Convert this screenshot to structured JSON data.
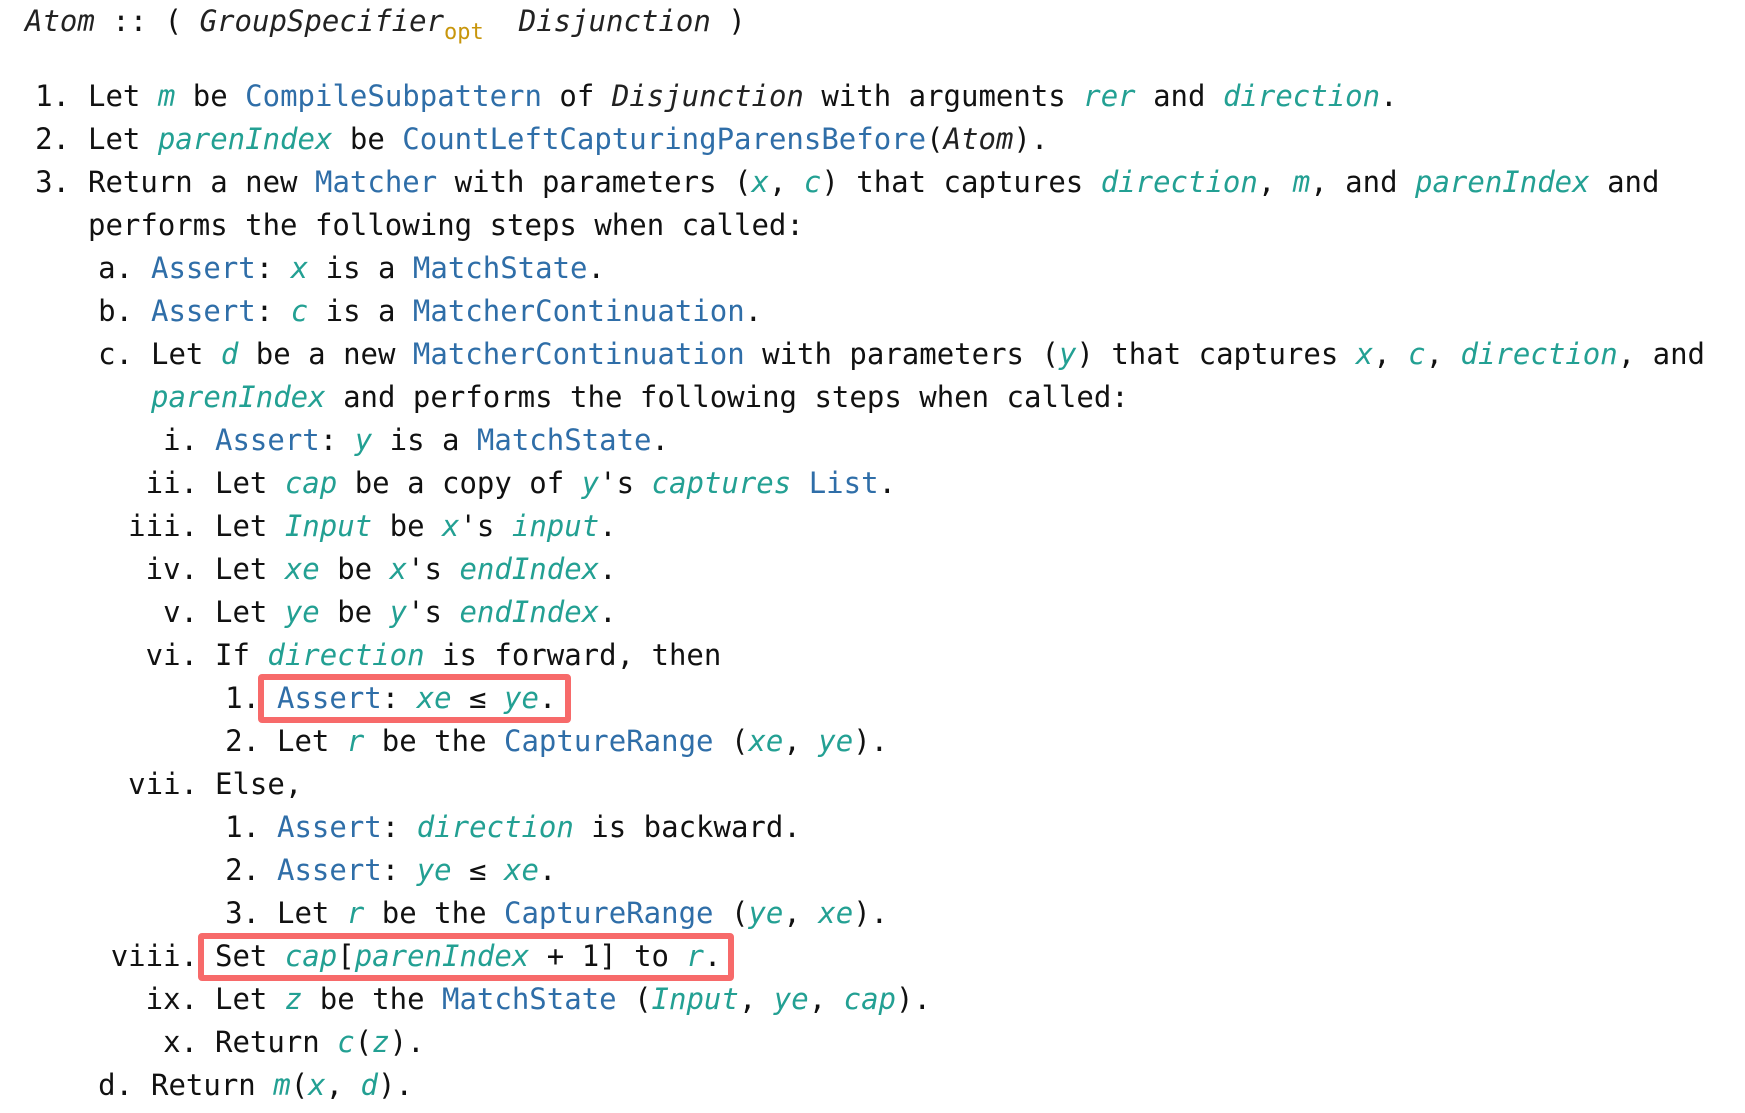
{
  "accent_colors": {
    "link": "#2f6ea8",
    "variable": "#23a093",
    "subscript": "#c8960c",
    "highlight_box": "#f76a6a"
  },
  "heading": [
    [
      "n",
      "Atom"
    ],
    [
      "t",
      " :: ( "
    ],
    [
      "n",
      "GroupSpecifier"
    ],
    [
      "sub",
      "opt"
    ],
    [
      "t",
      "  "
    ],
    [
      "n",
      "Disjunction"
    ],
    [
      "t",
      " )"
    ]
  ],
  "lines": [
    {
      "marker": "1.",
      "segments": [
        [
          "t",
          "Let "
        ],
        [
          "v",
          "m"
        ],
        [
          "t",
          " be "
        ],
        [
          "a",
          "CompileSubpattern"
        ],
        [
          "t",
          " of "
        ],
        [
          "n",
          "Disjunction"
        ],
        [
          "t",
          " with arguments "
        ],
        [
          "v",
          "rer"
        ],
        [
          "t",
          " and "
        ],
        [
          "v",
          "direction"
        ],
        [
          "t",
          "."
        ]
      ]
    },
    {
      "marker": "2.",
      "segments": [
        [
          "t",
          "Let "
        ],
        [
          "v",
          "parenIndex"
        ],
        [
          "t",
          " be "
        ],
        [
          "a",
          "CountLeftCapturingParensBefore"
        ],
        [
          "t",
          "("
        ],
        [
          "n",
          "Atom"
        ],
        [
          "t",
          ")."
        ]
      ]
    },
    {
      "marker": "3.",
      "segments": [
        [
          "t",
          "Return a new "
        ],
        [
          "a",
          "Matcher"
        ],
        [
          "t",
          " with parameters ("
        ],
        [
          "v",
          "x"
        ],
        [
          "t",
          ", "
        ],
        [
          "v",
          "c"
        ],
        [
          "t",
          ") that captures "
        ],
        [
          "v",
          "direction"
        ],
        [
          "t",
          ", "
        ],
        [
          "v",
          "m"
        ],
        [
          "t",
          ", and "
        ],
        [
          "v",
          "parenIndex"
        ],
        [
          "t",
          " and"
        ]
      ]
    },
    {
      "marker": "",
      "segments": [
        [
          "t",
          "performs the following steps when called:"
        ]
      ]
    },
    {
      "marker": "a.",
      "segments": [
        [
          "a",
          "Assert"
        ],
        [
          "t",
          ": "
        ],
        [
          "v",
          "x"
        ],
        [
          "t",
          " is a "
        ],
        [
          "a",
          "MatchState"
        ],
        [
          "t",
          "."
        ]
      ]
    },
    {
      "marker": "b.",
      "segments": [
        [
          "a",
          "Assert"
        ],
        [
          "t",
          ": "
        ],
        [
          "v",
          "c"
        ],
        [
          "t",
          " is a "
        ],
        [
          "a",
          "MatcherContinuation"
        ],
        [
          "t",
          "."
        ]
      ]
    },
    {
      "marker": "c.",
      "segments": [
        [
          "t",
          "Let "
        ],
        [
          "v",
          "d"
        ],
        [
          "t",
          " be a new "
        ],
        [
          "a",
          "MatcherContinuation"
        ],
        [
          "t",
          " with parameters ("
        ],
        [
          "v",
          "y"
        ],
        [
          "t",
          ") that captures "
        ],
        [
          "v",
          "x"
        ],
        [
          "t",
          ", "
        ],
        [
          "v",
          "c"
        ],
        [
          "t",
          ", "
        ],
        [
          "v",
          "direction"
        ],
        [
          "t",
          ", and"
        ]
      ]
    },
    {
      "marker": "",
      "segments": [
        [
          "v",
          "parenIndex"
        ],
        [
          "t",
          " and performs the following steps when called:"
        ]
      ]
    },
    {
      "marker": "i.",
      "segments": [
        [
          "a",
          "Assert"
        ],
        [
          "t",
          ": "
        ],
        [
          "v",
          "y"
        ],
        [
          "t",
          " is a "
        ],
        [
          "a",
          "MatchState"
        ],
        [
          "t",
          "."
        ]
      ]
    },
    {
      "marker": "ii.",
      "segments": [
        [
          "t",
          "Let "
        ],
        [
          "v",
          "cap"
        ],
        [
          "t",
          " be a copy of "
        ],
        [
          "v",
          "y"
        ],
        [
          "t",
          "'s "
        ],
        [
          "v",
          "captures"
        ],
        [
          "t",
          " "
        ],
        [
          "a",
          "List"
        ],
        [
          "t",
          "."
        ]
      ]
    },
    {
      "marker": "iii.",
      "segments": [
        [
          "t",
          "Let "
        ],
        [
          "v",
          "Input"
        ],
        [
          "t",
          " be "
        ],
        [
          "v",
          "x"
        ],
        [
          "t",
          "'s "
        ],
        [
          "v",
          "input"
        ],
        [
          "t",
          "."
        ]
      ]
    },
    {
      "marker": "iv.",
      "segments": [
        [
          "t",
          "Let "
        ],
        [
          "v",
          "xe"
        ],
        [
          "t",
          " be "
        ],
        [
          "v",
          "x"
        ],
        [
          "t",
          "'s "
        ],
        [
          "v",
          "endIndex"
        ],
        [
          "t",
          "."
        ]
      ]
    },
    {
      "marker": "v.",
      "segments": [
        [
          "t",
          "Let "
        ],
        [
          "v",
          "ye"
        ],
        [
          "t",
          " be "
        ],
        [
          "v",
          "y"
        ],
        [
          "t",
          "'s "
        ],
        [
          "v",
          "endIndex"
        ],
        [
          "t",
          "."
        ]
      ]
    },
    {
      "marker": "vi.",
      "segments": [
        [
          "t",
          "If "
        ],
        [
          "v",
          "direction"
        ],
        [
          "t",
          " is forward, then"
        ]
      ]
    },
    {
      "marker": "1.",
      "segments": [
        [
          "a",
          "Assert"
        ],
        [
          "t",
          ": "
        ],
        [
          "v",
          "xe"
        ],
        [
          "t",
          " ≤ "
        ],
        [
          "v",
          "ye"
        ],
        [
          "t",
          "."
        ]
      ]
    },
    {
      "marker": "2.",
      "segments": [
        [
          "t",
          "Let "
        ],
        [
          "v",
          "r"
        ],
        [
          "t",
          " be the "
        ],
        [
          "a",
          "CaptureRange"
        ],
        [
          "t",
          " ("
        ],
        [
          "v",
          "xe"
        ],
        [
          "t",
          ", "
        ],
        [
          "v",
          "ye"
        ],
        [
          "t",
          ")."
        ]
      ]
    },
    {
      "marker": "vii.",
      "segments": [
        [
          "t",
          "Else,"
        ]
      ]
    },
    {
      "marker": "1.",
      "segments": [
        [
          "a",
          "Assert"
        ],
        [
          "t",
          ": "
        ],
        [
          "v",
          "direction"
        ],
        [
          "t",
          " is backward."
        ]
      ]
    },
    {
      "marker": "2.",
      "segments": [
        [
          "a",
          "Assert"
        ],
        [
          "t",
          ": "
        ],
        [
          "v",
          "ye"
        ],
        [
          "t",
          " ≤ "
        ],
        [
          "v",
          "xe"
        ],
        [
          "t",
          "."
        ]
      ]
    },
    {
      "marker": "3.",
      "segments": [
        [
          "t",
          "Let "
        ],
        [
          "v",
          "r"
        ],
        [
          "t",
          " be the "
        ],
        [
          "a",
          "CaptureRange"
        ],
        [
          "t",
          " ("
        ],
        [
          "v",
          "ye"
        ],
        [
          "t",
          ", "
        ],
        [
          "v",
          "xe"
        ],
        [
          "t",
          ")."
        ]
      ]
    },
    {
      "marker": "viii.",
      "segments": [
        [
          "t",
          "Set "
        ],
        [
          "v",
          "cap"
        ],
        [
          "t",
          "["
        ],
        [
          "v",
          "parenIndex"
        ],
        [
          "t",
          " + 1] to "
        ],
        [
          "v",
          "r"
        ],
        [
          "t",
          "."
        ]
      ]
    },
    {
      "marker": "ix.",
      "segments": [
        [
          "t",
          "Let "
        ],
        [
          "v",
          "z"
        ],
        [
          "t",
          " be the "
        ],
        [
          "a",
          "MatchState"
        ],
        [
          "t",
          " ("
        ],
        [
          "v",
          "Input"
        ],
        [
          "t",
          ", "
        ],
        [
          "v",
          "ye"
        ],
        [
          "t",
          ", "
        ],
        [
          "v",
          "cap"
        ],
        [
          "t",
          ")."
        ]
      ]
    },
    {
      "marker": "x.",
      "segments": [
        [
          "t",
          "Return "
        ],
        [
          "v",
          "c"
        ],
        [
          "t",
          "("
        ],
        [
          "v",
          "z"
        ],
        [
          "t",
          ")."
        ]
      ]
    },
    {
      "marker": "d.",
      "segments": [
        [
          "t",
          "Return "
        ],
        [
          "v",
          "m"
        ],
        [
          "t",
          "("
        ],
        [
          "v",
          "x"
        ],
        [
          "t",
          ", "
        ],
        [
          "v",
          "d"
        ],
        [
          "t",
          ")."
        ]
      ]
    }
  ]
}
